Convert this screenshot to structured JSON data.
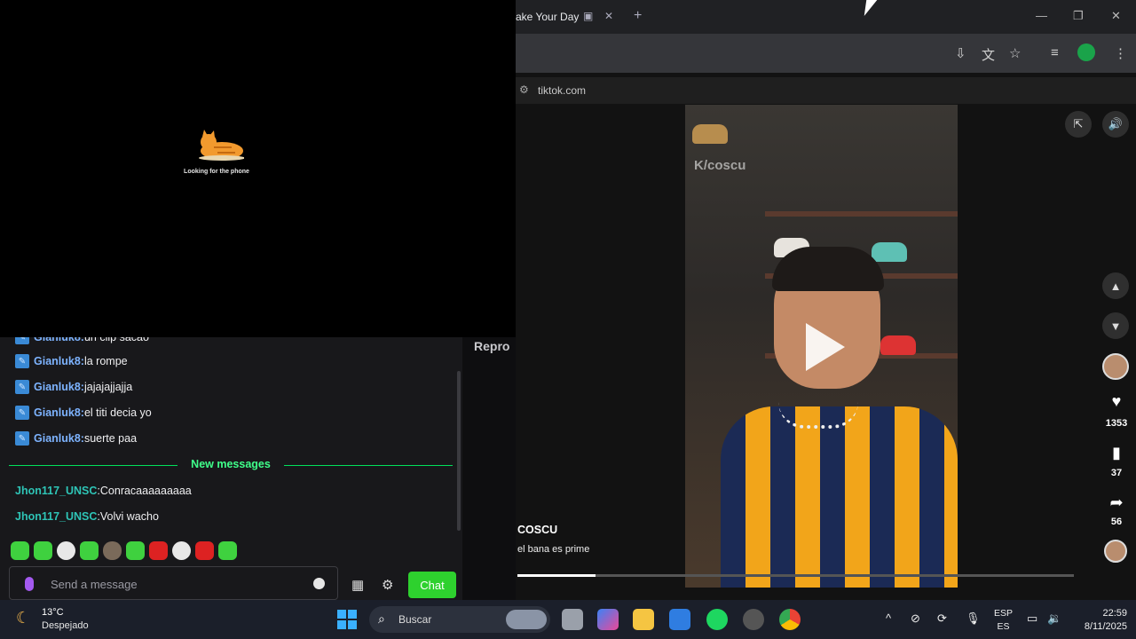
{
  "overlay": {
    "status_text": "Looking for the phone"
  },
  "chat": {
    "messages": [
      {
        "user": "Gianluk8",
        "sep": ": ",
        "text": "un clip sacao"
      },
      {
        "user": "Gianluk8",
        "sep": ": ",
        "text": "la rompe"
      },
      {
        "user": "Gianluk8",
        "sep": ": ",
        "text": "jajajajjajja"
      },
      {
        "user": "Gianluk8",
        "sep": ": ",
        "text": "el titi decia yo"
      },
      {
        "user": "Gianluk8",
        "sep": ": ",
        "text": "suerte paa"
      }
    ],
    "new_messages_label": "New messages",
    "new_messages": [
      {
        "user": "Jhon117_UNSC",
        "sep": ": ",
        "text": "Conracaaaaaaaaa"
      },
      {
        "user": "Jhon117_UNSC",
        "sep": ": ",
        "text": "Volvi wacho"
      }
    ],
    "input_placeholder": "Send a message",
    "chat_button": "Chat",
    "side_label": "Repro"
  },
  "browser": {
    "tab_title": "ake Your Day",
    "url": "tiktok.com",
    "video": {
      "watermark": "K/coscu",
      "author": "COSCU",
      "caption": "el bana es prime",
      "progress": 0.14
    },
    "actions": {
      "likes": "1353",
      "saves": "37",
      "shares": "56"
    }
  },
  "taskbar": {
    "temperature": "13°C",
    "weather": "Despejado",
    "search_placeholder": "Buscar",
    "lang_top": "ESP",
    "lang_bottom": "ES",
    "time": "22:59",
    "date": "8/11/2025"
  },
  "colors": {
    "chat_green": "#2ed12e",
    "new_msg_line": "#00e05c",
    "taskbar": "#1b1f2a"
  }
}
